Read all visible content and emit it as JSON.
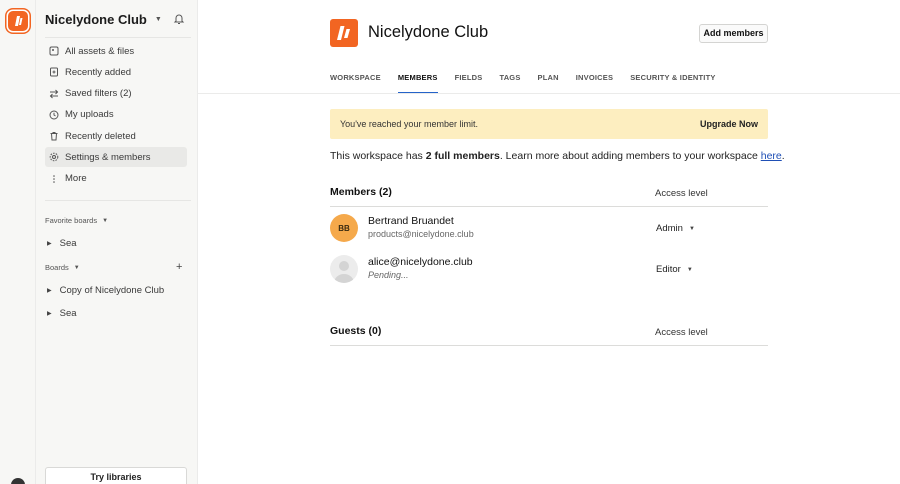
{
  "sidebar": {
    "workspace_name": "Nicelydone Club",
    "nav": [
      {
        "label": "All assets & files",
        "icon": "assets-icon"
      },
      {
        "label": "Recently added",
        "icon": "recently-added-icon"
      },
      {
        "label": "Saved filters (2)",
        "icon": "filters-icon"
      },
      {
        "label": "My uploads",
        "icon": "clock-icon"
      },
      {
        "label": "Recently deleted",
        "icon": "trash-icon"
      },
      {
        "label": "Settings & members",
        "icon": "gear-icon",
        "active": true
      },
      {
        "label": "More",
        "icon": "more-vertical-icon"
      }
    ],
    "favorite_boards_label": "Favorite boards",
    "favorite_boards": [
      "Sea"
    ],
    "boards_label": "Boards",
    "boards": [
      "Copy of Nicelydone Club",
      "Sea"
    ],
    "try_libraries": "Try libraries"
  },
  "main": {
    "title": "Nicelydone Club",
    "add_members": "Add members",
    "tabs": [
      "WORKSPACE",
      "MEMBERS",
      "FIELDS",
      "TAGS",
      "PLAN",
      "INVOICES",
      "SECURITY & IDENTITY"
    ],
    "active_tab": "MEMBERS",
    "banner": {
      "text": "You've reached your member limit.",
      "link": "Upgrade Now"
    },
    "info": {
      "prefix": "This workspace has ",
      "bold": "2 full members",
      "middle": ". Learn more about adding members to your workspace ",
      "link": "here",
      "suffix": "."
    },
    "members_title": "Members (2)",
    "access_level": "Access level",
    "members": [
      {
        "initials": "BB",
        "name": "Bertrand Bruandet",
        "sub": "products@nicelydone.club",
        "role": "Admin"
      },
      {
        "initials": "",
        "name": "alice@nicelydone.club",
        "sub": "Pending...",
        "role": "Editor"
      }
    ],
    "guests_title": "Guests (0)"
  },
  "colors": {
    "brand": "#f26522",
    "accent": "#2563c9",
    "banner": "#fdeec0",
    "avatar": "#f5a94b"
  }
}
